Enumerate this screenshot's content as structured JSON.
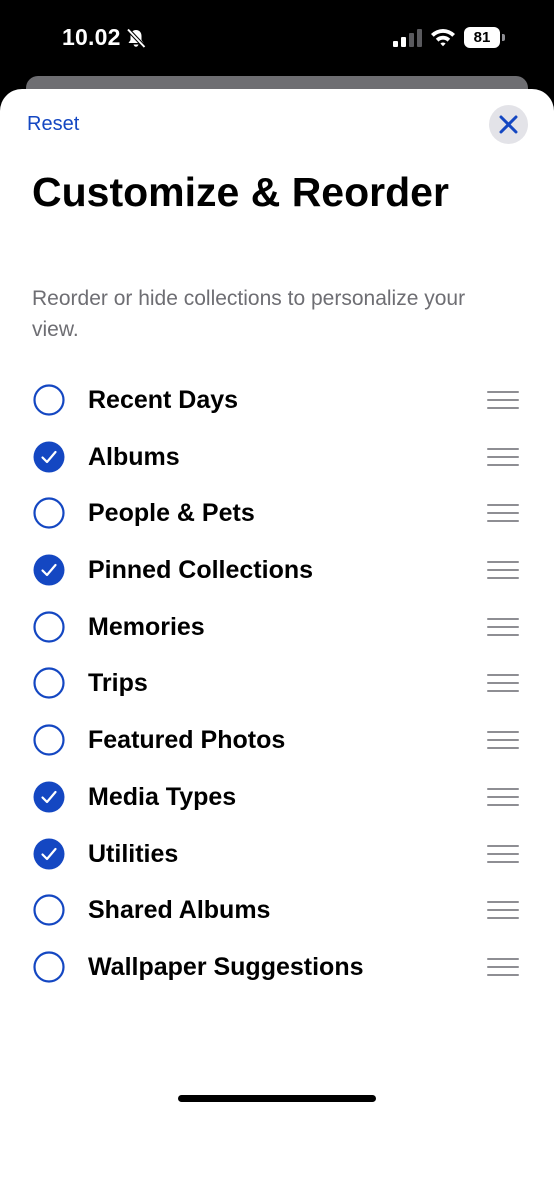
{
  "status_bar": {
    "time": "10.02",
    "battery": "81"
  },
  "sheet": {
    "reset_label": "Reset",
    "title": "Customize & Reorder",
    "subtitle": "Reorder or hide collections to personalize your view."
  },
  "colors": {
    "accent": "#1447c2",
    "subtitle_gray": "#6e6e73",
    "close_bg": "#e3e3e8"
  },
  "collections": [
    {
      "label": "Recent Days",
      "checked": false
    },
    {
      "label": "Albums",
      "checked": true
    },
    {
      "label": "People & Pets",
      "checked": false
    },
    {
      "label": "Pinned Collections",
      "checked": true
    },
    {
      "label": "Memories",
      "checked": false
    },
    {
      "label": "Trips",
      "checked": false
    },
    {
      "label": "Featured Photos",
      "checked": false
    },
    {
      "label": "Media Types",
      "checked": true
    },
    {
      "label": "Utilities",
      "checked": true
    },
    {
      "label": "Shared Albums",
      "checked": false
    },
    {
      "label": "Wallpaper Suggestions",
      "checked": false
    }
  ]
}
